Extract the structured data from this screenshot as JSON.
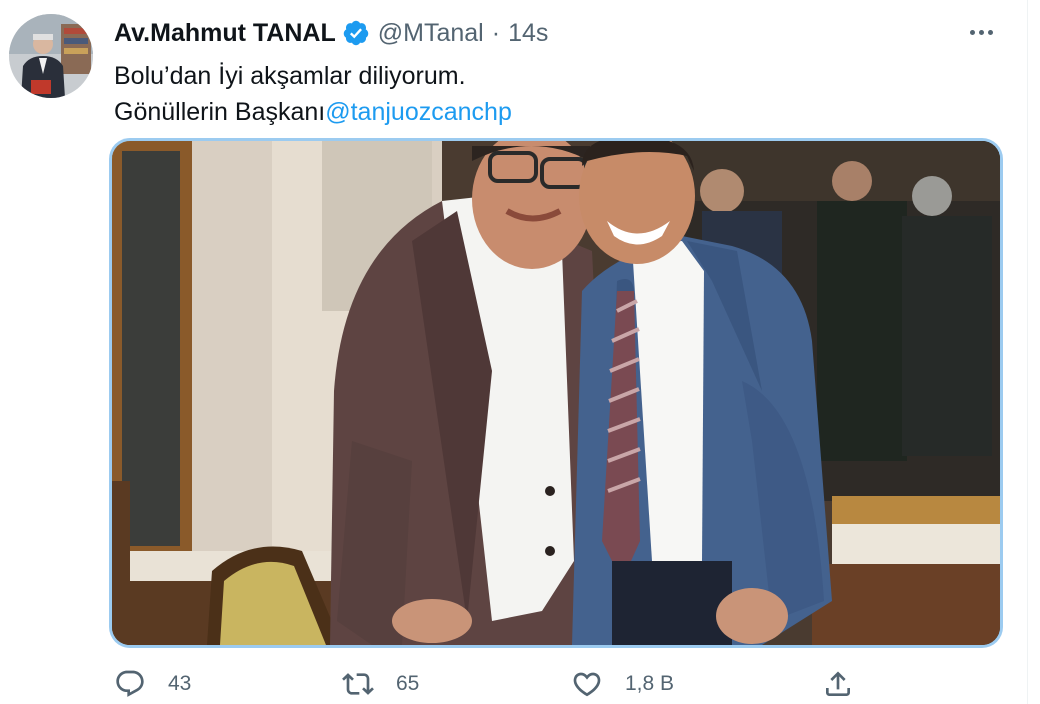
{
  "tweet": {
    "display_name": "Av.Mahmut TANAL",
    "handle": "@MTanal",
    "separator": "·",
    "time": "14s",
    "text_line1": "Bolu’dan İyi akşamlar diliyorum.",
    "text_line2_prefix": "Gönüllerin Başkanı",
    "mention": "@tanjuozcanchp",
    "verified_icon": "verified-badge-icon",
    "media_description_icon": "photo"
  },
  "actions": {
    "reply_count": "43",
    "retweet_count": "65",
    "like_count": "1,8 B"
  },
  "colors": {
    "accent": "#1d9bf0",
    "secondary_text": "#536471",
    "primary_text": "#0f1419",
    "media_border": "#9ccbf0"
  }
}
